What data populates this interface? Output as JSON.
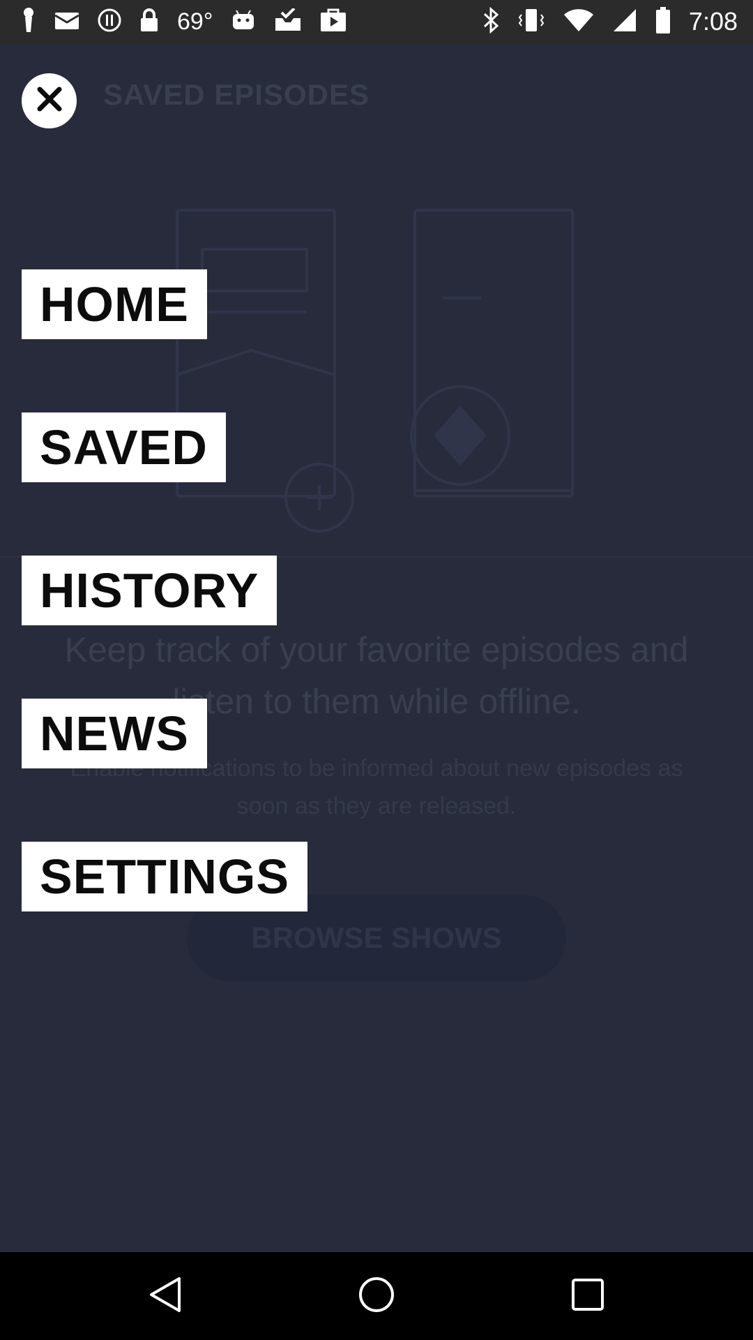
{
  "status_bar": {
    "temperature": "69°",
    "time": "7:08",
    "left_icons": [
      "notification-icon",
      "mail-icon",
      "info-icon",
      "lock-icon",
      "temperature-text",
      "android-icon",
      "inbox-check-icon",
      "play-store-icon"
    ],
    "right_icons": [
      "bluetooth-icon",
      "vibrate-icon",
      "wifi-icon",
      "signal-icon",
      "battery-icon"
    ]
  },
  "background": {
    "title": "SAVED EPISODES",
    "headline": "Keep track of your favorite episodes and listen to them while offline.",
    "subtext": "Enable notifications to be informed about new episodes as soon as they are released.",
    "browse_button": "BROWSE SHOWS"
  },
  "menu": {
    "items": [
      {
        "label": "HOME"
      },
      {
        "label": "SAVED"
      },
      {
        "label": "HISTORY"
      },
      {
        "label": "NEWS"
      },
      {
        "label": "SETTINGS"
      }
    ]
  },
  "colors": {
    "overlay_bg": "#272b3b",
    "menu_item_bg": "#ffffff",
    "menu_item_text": "#0c0c0c",
    "status_bar_bg": "#2b2b2b",
    "nav_bar_bg": "#000000"
  },
  "nav_bar": {
    "icons": [
      "back-icon",
      "home-circle-icon",
      "recents-icon"
    ]
  }
}
